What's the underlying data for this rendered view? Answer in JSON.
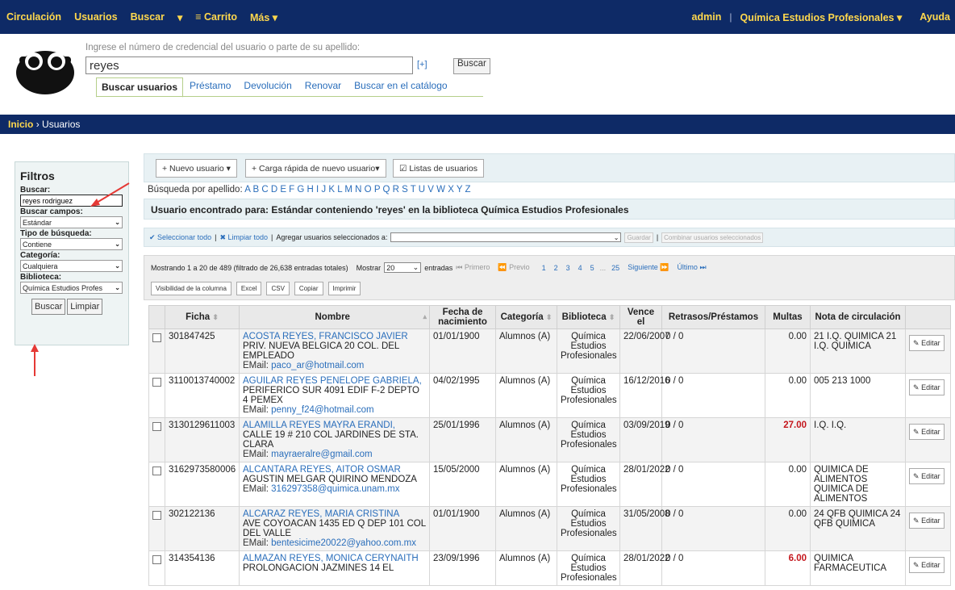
{
  "navbar": {
    "left": [
      "Circulación",
      "Usuarios",
      "Buscar",
      "▾",
      "≡ Carrito",
      "Más ▾"
    ],
    "user": "admin",
    "library": "Química Estudios Profesionales ▾",
    "help": "Ayuda"
  },
  "search": {
    "hint": "Ingrese el número de credencial del usuario o parte de su apellido:",
    "value": "reyes",
    "plus": "[+]",
    "button": "Buscar"
  },
  "tabs": [
    "Buscar usuarios",
    "Préstamo",
    "Devolución",
    "Renovar",
    "Buscar en el catálogo"
  ],
  "breadcrumb": {
    "home": "Inicio",
    "sep": "›",
    "current": "Usuarios"
  },
  "filters": {
    "title": "Filtros",
    "search_label": "Buscar:",
    "search_value": "reyes rodriguez",
    "fields_label": "Buscar campos:",
    "fields_value": "Estándar",
    "type_label": "Tipo de búsqueda:",
    "type_value": "Contiene",
    "category_label": "Categoría:",
    "category_value": "Cualquiera",
    "library_label": "Biblioteca:",
    "library_value": "Química Estudios Profes",
    "search_btn": "Buscar",
    "clear_btn": "Limpiar"
  },
  "toolbar": {
    "new_patron": "+ Nuevo usuario ▾",
    "quick_add": "+ Carga rápida de nuevo usuario▾",
    "lists": "☑ Listas de usuarios"
  },
  "alpha": {
    "label": "Búsqueda por apellido:",
    "letters": "A B C D E F G H I J K L M N O P Q R S T U V W X Y Z"
  },
  "result_title": "Usuario encontrado para: Estándar conteniendo 'reyes' en la biblioteca Química Estudios Profesionales",
  "selection": {
    "select_all": "✔ Seleccionar todo",
    "clear_all": "✖ Limpiar todo",
    "add_label": "Agregar usuarios seleccionados a:",
    "save": "Guardar",
    "merge": "Combinar usuarios seleccionados"
  },
  "pagination": {
    "showing": "Mostrando 1 a 20 de 489 (filtrado de 26,638 entradas totales)",
    "show": "Mostrar",
    "per_page": "20",
    "entries": "entradas",
    "first": "Primero",
    "prev": "Previo",
    "pages": [
      "1",
      "2",
      "3",
      "4",
      "5",
      "...",
      "25"
    ],
    "next": "Siguiente",
    "last": "Último",
    "buttons": [
      "Visibilidad de la columna",
      "Excel",
      "CSV",
      "Copiar",
      "Imprimir"
    ]
  },
  "table": {
    "headers": [
      "Ficha",
      "Nombre",
      "Fecha de nacimiento",
      "Categoría",
      "Biblioteca",
      "Vence el",
      "Retrasos/Préstamos",
      "Multas",
      "Nota de circulación"
    ],
    "rows": [
      {
        "ficha": "301847425",
        "name": "ACOSTA REYES, FRANCISCO JAVIER",
        "address": "PRIV. NUEVA BELGICA 20 COL. DEL EMPLEADO",
        "email": "paco_ar@hotmail.com",
        "dob": "01/01/1900",
        "category": "Alumnos (A)",
        "library": "Química Estudios Profesionales",
        "expires": "22/06/2007",
        "loans": "0 / 0",
        "fines": "0.00",
        "note": "21 I.Q. QUIMICA 21 I.Q. QUIMICA"
      },
      {
        "ficha": "3110013740002",
        "name": "AGUILAR REYES PENELOPE GABRIELA,",
        "address": "PERIFERICO SUR 4091 EDIF F-2 DEPTO 4 PEMEX",
        "email": "penny_f24@hotmail.com",
        "dob": "04/02/1995",
        "category": "Alumnos (A)",
        "library": "Química Estudios Profesionales",
        "expires": "16/12/2016",
        "loans": "0 / 0",
        "fines": "0.00",
        "note": "005 213 1000"
      },
      {
        "ficha": "3130129611003",
        "name": "ALAMILLA REYES MAYRA ERANDI,",
        "address": "CALLE 19 # 210 COL JARDINES DE STA. CLARA",
        "email": "mayraeralre@gmail.com",
        "dob": "25/01/1996",
        "category": "Alumnos (A)",
        "library": "Química Estudios Profesionales",
        "expires": "03/09/2019",
        "loans": "0 / 0",
        "fines": "27.00",
        "note": "I.Q. I.Q."
      },
      {
        "ficha": "3162973580006",
        "name": "ALCANTARA REYES, AITOR OSMAR",
        "address": "AGUSTIN MELGAR QUIRINO MENDOZA",
        "email": "316297358@quimica.unam.mx",
        "dob": "15/05/2000",
        "category": "Alumnos (A)",
        "library": "Química Estudios Profesionales",
        "expires": "28/01/2022",
        "loans": "0 / 0",
        "fines": "0.00",
        "note": "QUIMICA DE ALIMENTOS QUIMICA DE ALIMENTOS"
      },
      {
        "ficha": "302122136",
        "name": "ALCARAZ REYES, MARIA CRISTINA",
        "address": "AVE COYOACAN 1435 ED Q DEP 101 COL DEL VALLE",
        "email": "bentesicime20022@yahoo.com.mx",
        "dob": "01/01/1900",
        "category": "Alumnos (A)",
        "library": "Química Estudios Profesionales",
        "expires": "31/05/2008",
        "loans": "0 / 0",
        "fines": "0.00",
        "note": "24 QFB QUIMICA 24 QFB QUIMICA"
      },
      {
        "ficha": "314354136",
        "name": "ALMAZAN REYES, MONICA CERYNAITH",
        "address": "PROLONGACION JAZMINES 14 EL",
        "email": "",
        "dob": "23/09/1996",
        "category": "Alumnos (A)",
        "library": "Química Estudios Profesionales",
        "expires": "28/01/2022",
        "loans": "0 / 0",
        "fines": "6.00",
        "note": "QUIMICA FARMACEUTICA"
      }
    ],
    "email_label": "EMail:",
    "edit": "Editar"
  },
  "colors": {
    "navbar": "#0e2a66",
    "nav_text": "#ffd84d",
    "link": "#2a6ebb",
    "fine_red": "#c4161c",
    "arrow": "#e53935"
  }
}
